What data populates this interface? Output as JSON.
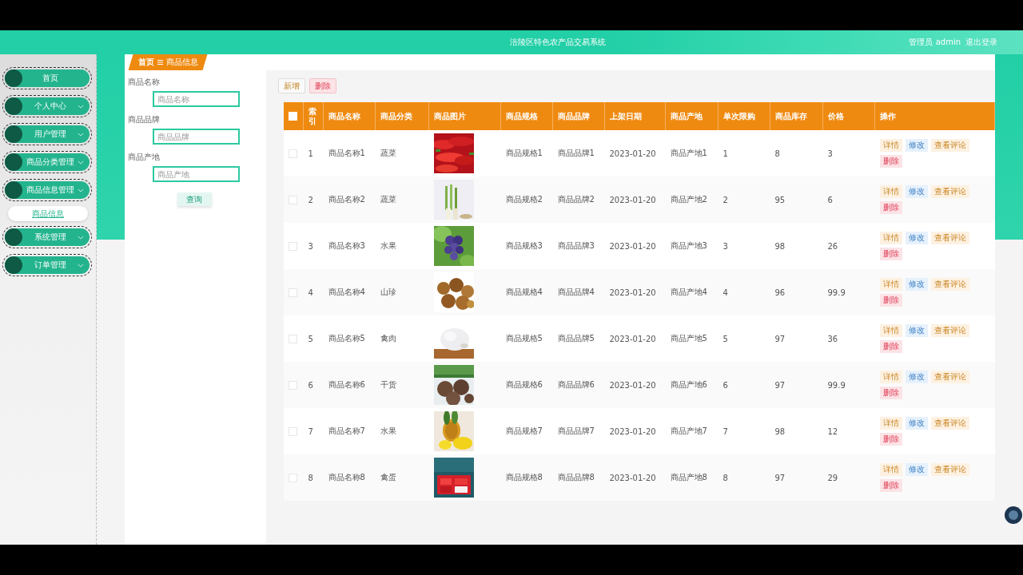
{
  "header": {
    "title": "涪陵区特色农产品交易系统",
    "user": "管理员 admin",
    "logout": "退出登录"
  },
  "sidebar": {
    "items": [
      {
        "label": "首页",
        "kind": "link"
      },
      {
        "label": "个人中心",
        "kind": "menu"
      },
      {
        "label": "用户管理",
        "kind": "menu"
      },
      {
        "label": "商品分类管理",
        "kind": "menu"
      },
      {
        "label": "商品信息管理",
        "kind": "menu",
        "children": [
          {
            "label": "商品信息",
            "selected": true
          }
        ]
      },
      {
        "label": "系统管理",
        "kind": "menu"
      },
      {
        "label": "订单管理",
        "kind": "menu"
      }
    ]
  },
  "breadcrumb": {
    "home": "首页",
    "current": "商品信息"
  },
  "search": {
    "fields": [
      {
        "label": "商品名称",
        "placeholder": "商品名称"
      },
      {
        "label": "商品品牌",
        "placeholder": "商品品牌"
      },
      {
        "label": "商品产地",
        "placeholder": "商品产地"
      }
    ],
    "button": "查询"
  },
  "toolbar": [
    {
      "label": "新增",
      "kind": "add"
    },
    {
      "label": "删除",
      "kind": "delete"
    }
  ],
  "table": {
    "select_all": {
      "checked": false
    },
    "columns": [
      "索引",
      "商品名称",
      "商品分类",
      "商品图片",
      "商品规格",
      "商品品牌",
      "上架日期",
      "商品产地",
      "单次限购",
      "商品库存",
      "价格",
      "操作"
    ],
    "rows": [
      {
        "checked": false,
        "cells": [
          "1",
          "商品名称1",
          "蔬菜"
        ],
        "image": {
          "kind": "picture"
        },
        "more": [
          "商品规格1",
          "商品品牌1",
          "2023-01-20",
          "商品产地1",
          "1",
          "8",
          "3"
        ],
        "actions": [
          {
            "label": "详情",
            "kind": "detail"
          },
          {
            "label": "修改",
            "kind": "edit"
          },
          {
            "label": "查看评论",
            "kind": "detail"
          },
          {
            "label": "删除",
            "kind": "delete"
          }
        ]
      },
      {
        "checked": false,
        "cells": [
          "2",
          "商品名称2",
          "蔬菜"
        ],
        "image": {
          "kind": "picture"
        },
        "more": [
          "商品规格2",
          "商品品牌2",
          "2023-01-20",
          "商品产地2",
          "2",
          "95",
          "6"
        ],
        "actions": [
          {
            "label": "详情",
            "kind": "detail"
          },
          {
            "label": "修改",
            "kind": "edit"
          },
          {
            "label": "查看评论",
            "kind": "detail"
          },
          {
            "label": "删除",
            "kind": "delete"
          }
        ]
      },
      {
        "checked": false,
        "cells": [
          "3",
          "商品名称3",
          "水果"
        ],
        "image": {
          "kind": "picture"
        },
        "more": [
          "商品规格3",
          "商品品牌3",
          "2023-01-20",
          "商品产地3",
          "3",
          "98",
          "26"
        ],
        "actions": [
          {
            "label": "详情",
            "kind": "detail"
          },
          {
            "label": "修改",
            "kind": "edit"
          },
          {
            "label": "查看评论",
            "kind": "detail"
          },
          {
            "label": "删除",
            "kind": "delete"
          }
        ]
      },
      {
        "checked": false,
        "cells": [
          "4",
          "商品名称4",
          "山珍"
        ],
        "image": {
          "kind": "picture"
        },
        "more": [
          "商品规格4",
          "商品品牌4",
          "2023-01-20",
          "商品产地4",
          "4",
          "96",
          "99.9"
        ],
        "actions": [
          {
            "label": "详情",
            "kind": "detail"
          },
          {
            "label": "修改",
            "kind": "edit"
          },
          {
            "label": "查看评论",
            "kind": "detail"
          },
          {
            "label": "删除",
            "kind": "delete"
          }
        ]
      },
      {
        "checked": false,
        "cells": [
          "5",
          "商品名称5",
          "禽肉"
        ],
        "image": {
          "kind": "picture"
        },
        "more": [
          "商品规格5",
          "商品品牌5",
          "2023-01-20",
          "商品产地5",
          "5",
          "97",
          "36"
        ],
        "actions": [
          {
            "label": "详情",
            "kind": "detail"
          },
          {
            "label": "修改",
            "kind": "edit"
          },
          {
            "label": "查看评论",
            "kind": "detail"
          },
          {
            "label": "删除",
            "kind": "delete"
          }
        ]
      },
      {
        "checked": false,
        "cells": [
          "6",
          "商品名称6",
          "干货"
        ],
        "image": {
          "kind": "picture"
        },
        "more": [
          "商品规格6",
          "商品品牌6",
          "2023-01-20",
          "商品产地6",
          "6",
          "97",
          "99.9"
        ],
        "actions": [
          {
            "label": "详情",
            "kind": "detail"
          },
          {
            "label": "修改",
            "kind": "edit"
          },
          {
            "label": "查看评论",
            "kind": "detail"
          },
          {
            "label": "删除",
            "kind": "delete"
          }
        ]
      },
      {
        "checked": false,
        "cells": [
          "7",
          "商品名称7",
          "水果"
        ],
        "image": {
          "kind": "picture"
        },
        "more": [
          "商品规格7",
          "商品品牌7",
          "2023-01-20",
          "商品产地7",
          "7",
          "98",
          "12"
        ],
        "actions": [
          {
            "label": "详情",
            "kind": "detail"
          },
          {
            "label": "修改",
            "kind": "edit"
          },
          {
            "label": "查看评论",
            "kind": "detail"
          },
          {
            "label": "删除",
            "kind": "delete"
          }
        ]
      },
      {
        "checked": false,
        "cells": [
          "8",
          "商品名称8",
          "禽蛋"
        ],
        "image": {
          "kind": "picture"
        },
        "more": [
          "商品规格8",
          "商品品牌8",
          "2023-01-20",
          "商品产地8",
          "8",
          "97",
          "29"
        ],
        "actions": [
          {
            "label": "详情",
            "kind": "detail"
          },
          {
            "label": "修改",
            "kind": "edit"
          },
          {
            "label": "查看评论",
            "kind": "detail"
          },
          {
            "label": "删除",
            "kind": "delete"
          }
        ]
      }
    ]
  }
}
